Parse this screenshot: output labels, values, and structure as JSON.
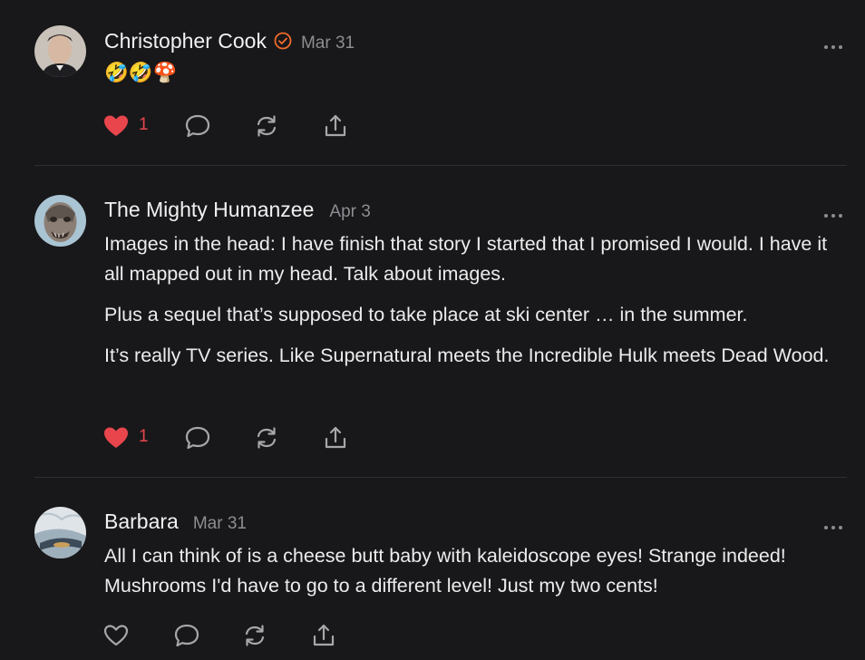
{
  "comments": [
    {
      "author": "Christopher Cook",
      "verified": true,
      "date": "Mar 31",
      "body": [
        "🤣🤣🍄"
      ],
      "liked": true,
      "like_count": "1"
    },
    {
      "author": "The Mighty Humanzee",
      "verified": false,
      "date": "Apr 3",
      "body": [
        "Images in the head: I have finish that story I started that I promised I would. I have it all mapped out in my head. Talk about images.",
        "Plus a sequel that’s supposed to take place at ski center … in the summer.",
        "It’s really TV series. Like Supernatural meets the Incredible Hulk meets Dead Wood."
      ],
      "liked": true,
      "like_count": "1"
    },
    {
      "author": "Barbara",
      "verified": false,
      "date": "Mar 31",
      "body": [
        "All I can think of is a cheese butt baby with kaleidoscope eyes! Strange indeed! Mushrooms I'd have to go to a different level! Just my two cents!"
      ],
      "liked": false,
      "like_count": ""
    }
  ],
  "icons": {
    "like": "heart-icon",
    "reply": "speech-bubble-icon",
    "restack": "refresh-icon",
    "share": "share-upload-icon",
    "more": "ellipsis-icon",
    "verified": "verified-badge-icon"
  },
  "colors": {
    "background": "#18181a",
    "like_active": "#e8454d",
    "verified": "#f26b2b",
    "muted": "#8d8d92"
  }
}
